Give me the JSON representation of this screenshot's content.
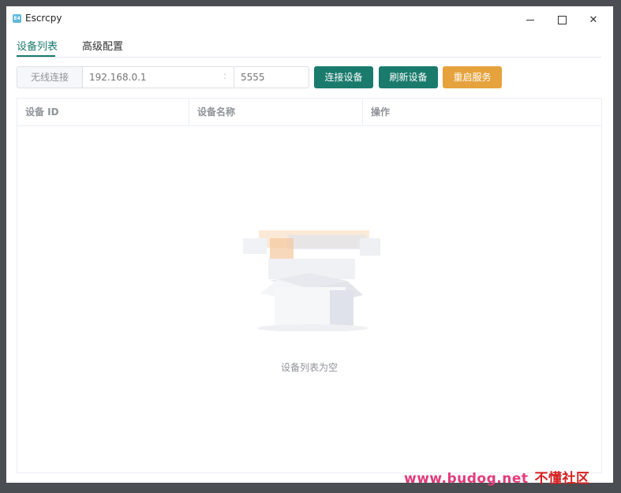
{
  "window": {
    "title": "Escrcpy",
    "icon_text": "E4",
    "controls": {
      "minimize": "minimize-icon",
      "maximize": "maximize-icon",
      "close": "close-icon",
      "close_glyph": "✕"
    }
  },
  "tabs": [
    {
      "label": "设备列表",
      "active": true
    },
    {
      "label": "高级配置",
      "active": false
    }
  ],
  "connection": {
    "label": "无线连接",
    "ip_placeholder": "192.168.0.1",
    "separator": ":",
    "port_placeholder": "5555",
    "buttons": {
      "connect": "连接设备",
      "refresh": "刷新设备",
      "restart": "重启服务"
    }
  },
  "table": {
    "columns": [
      "设备 ID",
      "设备名称",
      "操作"
    ],
    "rows": [],
    "empty_text": "设备列表为空"
  },
  "watermark": {
    "url": "www.budog.net",
    "text": "不懂社区"
  },
  "colors": {
    "primary": "#1a7b6d",
    "warning": "#e6a23c",
    "border": "#dcdfe6",
    "muted_text": "#909399"
  }
}
